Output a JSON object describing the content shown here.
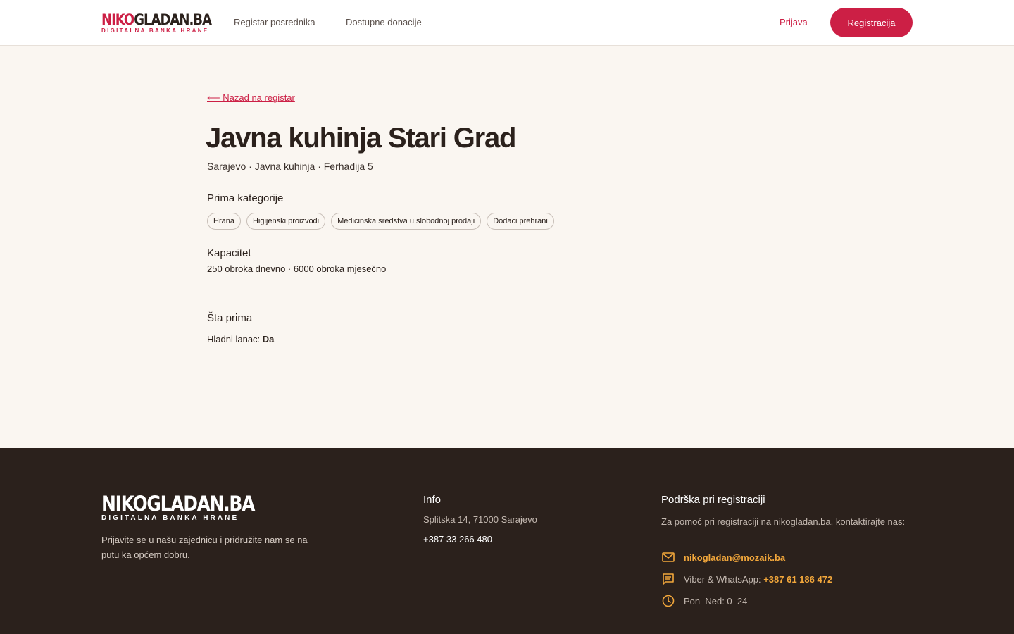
{
  "header": {
    "logo_main_red": "NIKO",
    "logo_main_dark": "GLADAN.BA",
    "logo_sub": "DIGITALNA BANKA HRANE",
    "nav": [
      {
        "label": "Registar posrednika"
      },
      {
        "label": "Dostupne donacije"
      }
    ],
    "login_label": "Prijava",
    "register_label": "Registracija"
  },
  "main": {
    "back_link": "⟵ Nazad na registar",
    "title": "Javna kuhinja Stari Grad",
    "subtitle": "Sarajevo · Javna kuhinja · Ferhadija 5",
    "categories_label": "Prima kategorije",
    "categories": [
      "Hrana",
      "Higijenski proizvodi",
      "Medicinska sredstva u slobodnoj prodaji",
      "Dodaci prehrani"
    ],
    "capacity_label": "Kapacitet",
    "capacity_value": "250 obroka dnevno · 6000 obroka mjesečno",
    "receives_label": "Šta prima",
    "cold_chain_label": "Hladni lanac:",
    "cold_chain_value": "Da"
  },
  "footer": {
    "logo_main": "NIKOGLADAN.BA",
    "logo_sub": "DIGITALNA BANKA HRANE",
    "tagline": "Prijavite se u našu zajednicu i pridružite nam se na putu ka općem dobru.",
    "info_heading": "Info",
    "address": "Splitska 14, 71000 Sarajevo",
    "phone": "+387 33 266 480",
    "support_heading": "Podrška pri registraciji",
    "support_text": "Za pomoć pri registraciji na nikogladan.ba, kontaktirajte nas:",
    "email": "nikogladan@mozaik.ba",
    "messaging_label": "Viber & WhatsApp:",
    "messaging_phone": "+387 61 186 472",
    "hours": "Pon–Ned: 0–24",
    "icons": {
      "mail": "mail-icon",
      "chat": "chat-icon",
      "clock": "clock-icon"
    },
    "accent_color": "#f2a73b"
  },
  "colors": {
    "brand": "#cc1f45",
    "background": "#faf6f1",
    "footer_bg": "#2b211c"
  }
}
